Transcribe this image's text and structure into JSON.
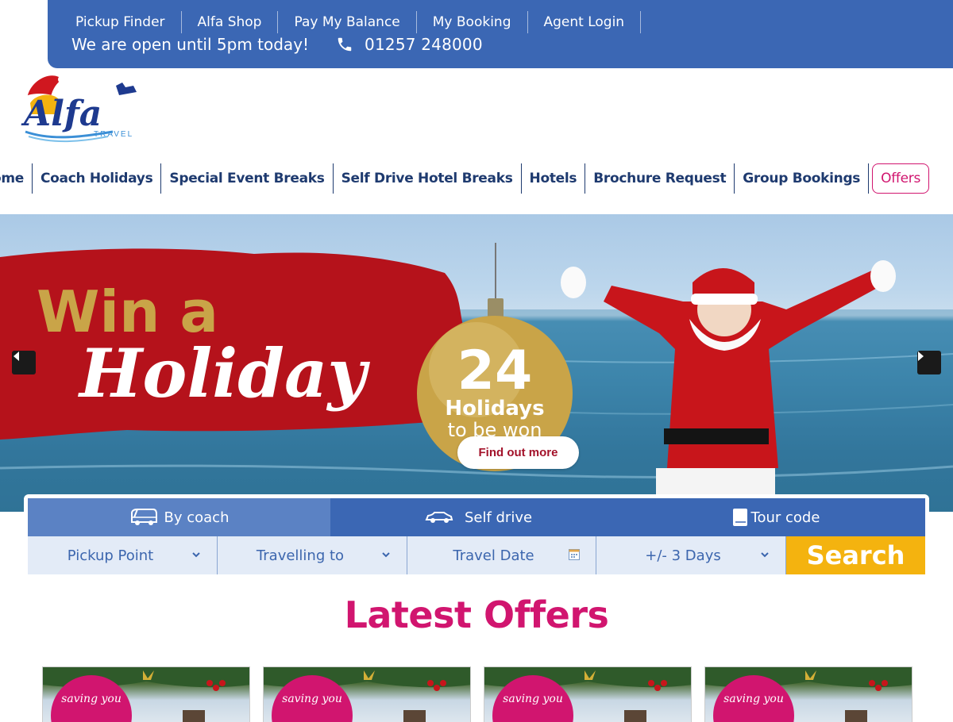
{
  "topbar": {
    "links": [
      "Pickup Finder",
      "Alfa Shop",
      "Pay My Balance",
      "My Booking",
      "Agent Login"
    ],
    "open_text": "We are open until 5pm today!",
    "phone": "01257 248000"
  },
  "logo": {
    "name": "Alfa",
    "sub": "TRAVEL"
  },
  "nav": {
    "items": [
      "Home",
      "Coach Holidays",
      "Special Event Breaks",
      "Self Drive Hotel Breaks",
      "Hotels",
      "Brochure Request",
      "Group Bookings"
    ],
    "offers": "Offers"
  },
  "hero": {
    "line1": "Win a",
    "line2": "Holiday",
    "bauble_number": "24",
    "bauble_line1": "Holidays",
    "bauble_line2": "to be won",
    "cta": "Find out more"
  },
  "search": {
    "tabs": [
      {
        "label": "By coach",
        "icon": "coach-icon"
      },
      {
        "label": "Self drive",
        "icon": "car-icon"
      },
      {
        "label": "Tour code",
        "icon": "book-icon"
      }
    ],
    "fields": {
      "pickup": "Pickup Point",
      "destination": "Travelling to",
      "date": "Travel Date",
      "flex": "+/- 3 Days"
    },
    "button": "Search"
  },
  "offers": {
    "title": "Latest Offers",
    "cards": [
      {
        "badge": "saving you"
      },
      {
        "badge": "saving you"
      },
      {
        "badge": "saving you"
      },
      {
        "badge": "saving you"
      }
    ]
  },
  "colors": {
    "brand_blue": "#3b67b4",
    "nav_text": "#1e3a6f",
    "accent_pink": "#d1156f",
    "search_yellow": "#f4b30f"
  }
}
